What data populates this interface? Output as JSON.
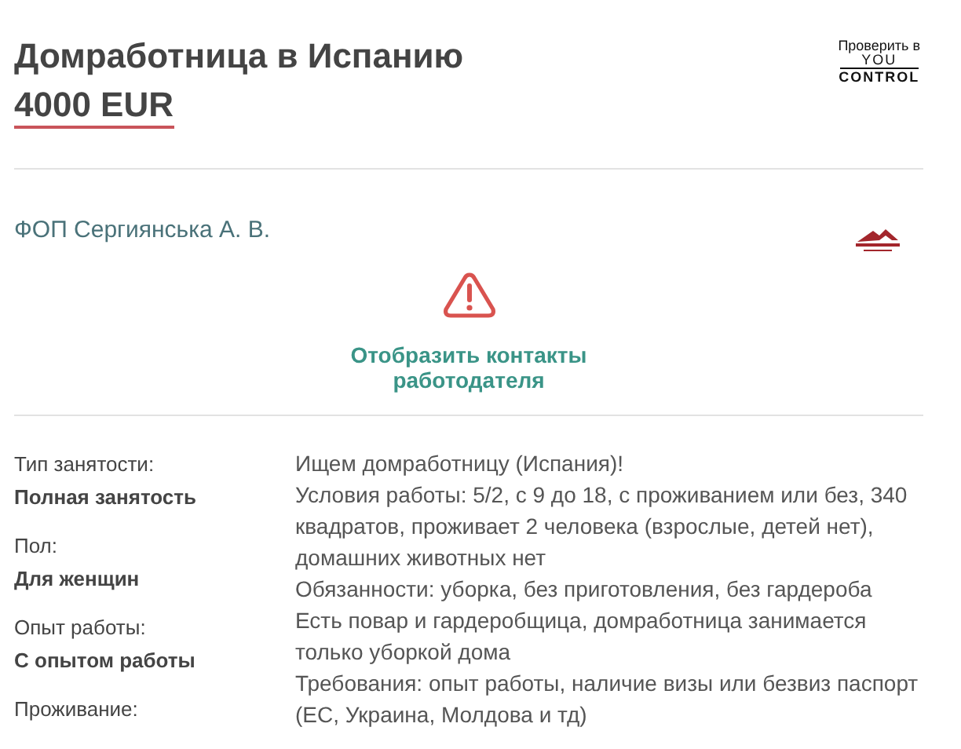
{
  "title": "Домработница в Испанию",
  "salary": "4000 EUR",
  "verify_badge": {
    "caption": "Проверить в",
    "line_1": "YOU",
    "line_2": "CONTROL"
  },
  "employer": {
    "name": "ФОП Сергиянська А. В."
  },
  "contacts_link": {
    "text": "Отобразить контакты работодателя"
  },
  "details": [
    {
      "label": "Тип занятости:",
      "value": "Полная занятость"
    },
    {
      "label": "Пол:",
      "value": "Для женщин"
    },
    {
      "label": "Опыт работы:",
      "value": "С опытом работы"
    },
    {
      "label": "Проживание:"
    }
  ],
  "description": [
    "Ищем домработницу (Испания)!",
    "Условия работы: 5/2, с 9 до 18, с проживанием или без, 340 квадратов, проживает 2 человека (взрослые, детей нет), домашних животных нет",
    "Обязанности: уборка, без приготовления, без гардероба",
    "Есть повар и гардеробщица, домработница занимается только уборкой дома",
    "Требования: опыт работы, наличие визы или безвиз паспорт (ЕС, Украина, Молдова и тд)"
  ]
}
